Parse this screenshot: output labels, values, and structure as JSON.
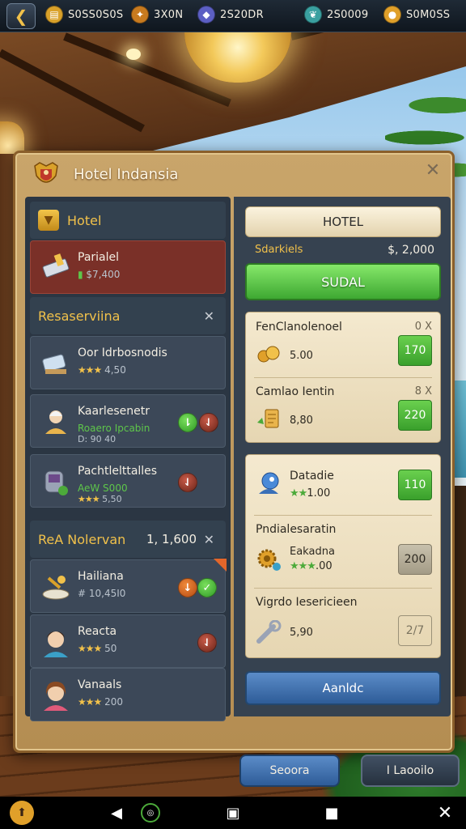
{
  "topbar": {
    "back_icon": "back-arrow-icon",
    "resources": [
      {
        "name": "coins",
        "icon": "coin-stack-icon",
        "color": "#d9a12a",
        "value": "S0SS0S0S"
      },
      {
        "name": "food",
        "icon": "food-plate-icon",
        "color": "#c77a1f",
        "value": "3X0N"
      },
      {
        "name": "gems",
        "icon": "gem-icon",
        "color": "#5c5fc4",
        "value": "2S20DR"
      },
      {
        "name": "energy",
        "icon": "leaf-drop-icon",
        "color": "#3aa0a0",
        "value": "2S0009"
      },
      {
        "name": "premium",
        "icon": "gold-coin-icon",
        "color": "#e0a02a",
        "value": "S0M0SS"
      }
    ]
  },
  "panel": {
    "title": "Hotel Indansia",
    "close_label": "✕"
  },
  "left": {
    "header": {
      "label": "Hotel"
    },
    "selected": {
      "name": "Parialel",
      "price": "$7,400"
    },
    "section1": {
      "label": "Resaserviina",
      "close": "✕"
    },
    "items1": [
      {
        "name": "Oor Idrbosnodis",
        "rating": "★★★",
        "rating_value": "4,50"
      },
      {
        "name": "Kaarlesenetr",
        "sub": "Roaero Ipcabin",
        "sub2": "D: 90 40"
      },
      {
        "name": "Pachtlelttalles",
        "sub": "AeW S000",
        "rating": "★★★",
        "rating_value": "5,50"
      }
    ],
    "section2": {
      "label": "ReA Nolervan",
      "amount": "1, 1,600",
      "close": "✕"
    },
    "items2": [
      {
        "name": "Hailiana",
        "sub": "# 10,45I0"
      },
      {
        "name": "Reacta",
        "rating": "★★★",
        "rating_value": "50"
      },
      {
        "name": "Vanaals",
        "rating": "★★★",
        "rating_value": "200"
      }
    ]
  },
  "right": {
    "hotel_button": "HOTEL",
    "price_label": "Sdarkiels",
    "price_value": "$, 2,000",
    "green_button": "SUDAL",
    "card1": [
      {
        "title": "FenClanolenoel",
        "tag": "0 X",
        "value": "5.00",
        "button": "170"
      },
      {
        "title": "Camlao Ientin",
        "tag": "8 X",
        "value": "8,80",
        "button": "220"
      }
    ],
    "card2": [
      {
        "title": "Datadie",
        "rating": "★★",
        "rating_value": "1.00",
        "button": "110"
      },
      {
        "title": "Pndialesaratin",
        "sub": "Eakadna",
        "rating": "★★★",
        "rating_value": ".00",
        "button": "200"
      },
      {
        "title": "Vigrdo Iesericieen",
        "value": "5,90",
        "button": "2/7"
      }
    ],
    "blue_button": "Aanldc"
  },
  "bottom": {
    "left_button": "Seoora",
    "right_button": "I Laooilo"
  },
  "navbar": {
    "items": [
      "settings-icon",
      "back-triangle-icon",
      "record-icon",
      "home-square-icon",
      "recents-square-icon",
      "close-x-icon"
    ]
  }
}
